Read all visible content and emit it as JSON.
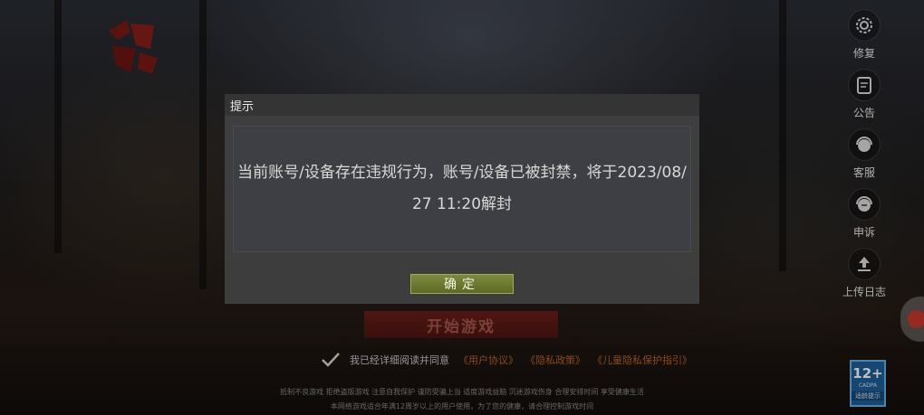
{
  "side_menu": [
    {
      "label": "修复",
      "icon": "gear-repair-icon"
    },
    {
      "label": "公告",
      "icon": "announcement-icon"
    },
    {
      "label": "客服",
      "icon": "customer-service-icon"
    },
    {
      "label": "申诉",
      "icon": "appeal-icon"
    },
    {
      "label": "上传日志",
      "icon": "upload-log-icon"
    }
  ],
  "start_button": {
    "label": "开始游戏"
  },
  "agreement": {
    "text": "我已经详细阅读并同意",
    "links": [
      "《用户协议》",
      "《隐私政策》",
      "《儿童隐私保护指引》"
    ]
  },
  "health_notice": [
    "抵制不良游戏 拒绝盗版游戏 注意自我保护 谨防受骗上当 适度游戏益脑 沉迷游戏伤身 合理安排时间 享受健康生活",
    "本网络游戏适合年满12周岁以上的用户使用，为了您的健康，请合理控制游戏时间"
  ],
  "age_rating": {
    "number": "12+",
    "sub": "CADPA",
    "foot": "适龄提示"
  },
  "dialog": {
    "title": "提示",
    "message": "当前账号/设备存在违规行为，账号/设备已被封禁，将于2023/08/27 11:20解封",
    "confirm_label": "确定"
  },
  "colors": {
    "start_button": "#5a1a14",
    "link": "#b8632a",
    "confirm_button": "#6e7b33",
    "age_badge": "#1f5e99"
  }
}
